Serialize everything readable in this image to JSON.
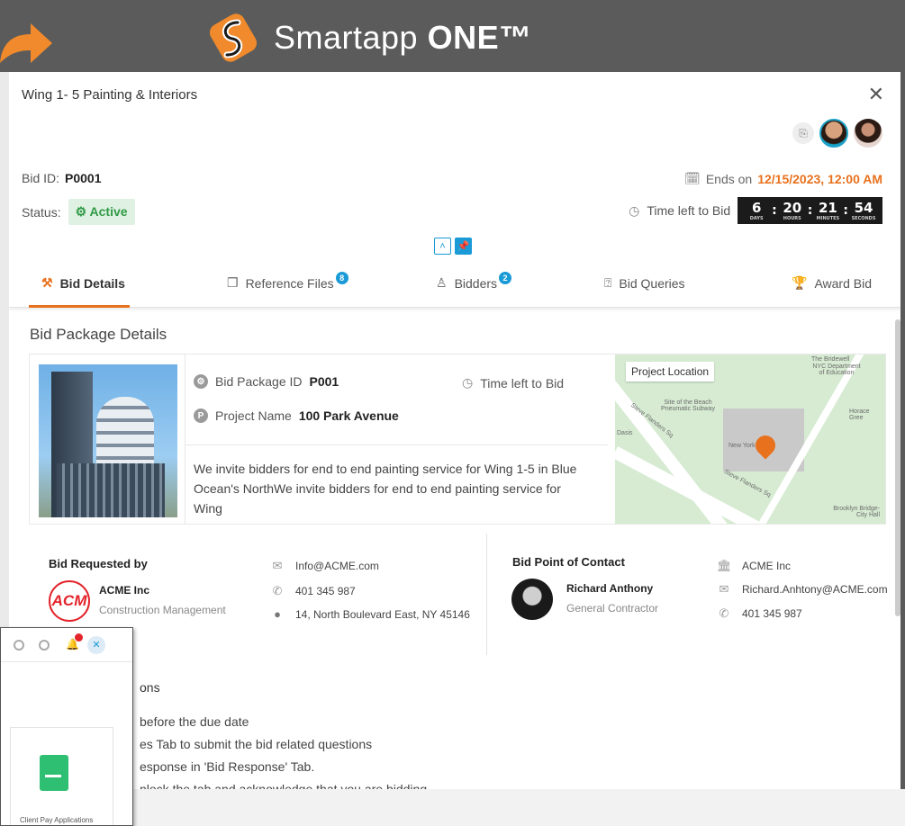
{
  "banner": {
    "brand_name": "Smartapp",
    "brand_bold": "ONE™"
  },
  "modal": {
    "title": "Wing 1- 5 Painting & Interiors",
    "close_glyph": "✕",
    "bid_id_label": "Bid ID:",
    "bid_id": "P0001",
    "status_label": "Status:",
    "status_value": "Active",
    "ends_label": "Ends on",
    "ends_value": "12/15/2023, 12:00 AM",
    "time_left_label": "Time left to Bid",
    "countdown": {
      "days": "6",
      "hours": "20",
      "minutes": "21",
      "seconds": "54",
      "days_label": "DAYS",
      "hours_label": "HOURS",
      "minutes_label": "MINUTES",
      "seconds_label": "SECONDS"
    }
  },
  "tabs": [
    {
      "label": "Bid Details",
      "active": true
    },
    {
      "label": "Reference Files",
      "count": "8"
    },
    {
      "label": "Bidders",
      "count": "2"
    },
    {
      "label": "Bid Queries"
    },
    {
      "label": "Award Bid"
    }
  ],
  "package": {
    "section_title": "Bid Package Details",
    "id_label": "Bid Package ID",
    "id_value": "P001",
    "time_left_label": "Time left to Bid",
    "project_label": "Project Name",
    "project_value": "100 Park Avenue",
    "description_1": "We invite bidders for end to end painting service for Wing 1-5 in Blue",
    "description_2": "Ocean's NorthWe invite bidders for end to end painting service for Wing",
    "map_label": "Project Location",
    "map_texts": [
      "The Bridewell",
      "NYC Department of Education",
      "Site of the Beach Pneumatic Subway",
      "Horace Gree",
      "Dasis",
      "New York",
      "Brooklyn Bridge-City Hall",
      "Steve Flanders Sq",
      "Steve Flanders Sq"
    ]
  },
  "requested_by": {
    "heading": "Bid Requested by",
    "company": "ACME Inc",
    "role": "Construction Management",
    "logo_text": "ACM",
    "email": "Info@ACME.com",
    "phone": "401 345 987",
    "address": "14, North Boulevard East, NY 45146"
  },
  "point_of_contact": {
    "heading": "Bid Point of Contact",
    "name": "Richard Anthony",
    "role": "General Contractor",
    "company": "ACME Inc",
    "email": "Richard.Anhtony@ACME.com",
    "phone": "401 345 987"
  },
  "instructions": {
    "heading_partial": "ons",
    "line_1": "before the due date",
    "line_2": "es Tab to submit the bid related questions",
    "line_3": "esponse in 'Bid Response' Tab.",
    "line_4": "nlock the tab and acknowledge that you are bidding"
  },
  "panel": {
    "card_label": "Client Pay Applications",
    "notification_count": ""
  },
  "colors": {
    "accent": "#e8711d",
    "primary": "#1a9ad6",
    "active_green": "#2f9a45",
    "header_bg": "#5b5b5b"
  }
}
